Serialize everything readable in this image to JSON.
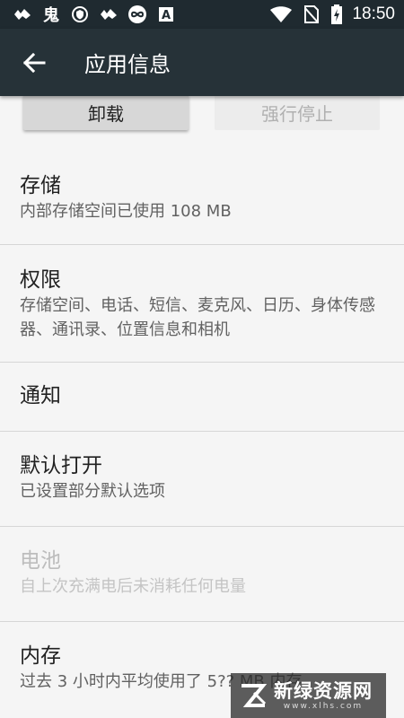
{
  "status_bar": {
    "time": "18:50",
    "left_icons": [
      "notification-app-icon",
      "ghost-app-icon",
      "shield-app-icon",
      "notification-app-icon",
      "infinity-app-icon",
      "font-app-icon"
    ],
    "right_icons": [
      "wifi-icon",
      "no-sim-icon",
      "battery-charging-icon"
    ]
  },
  "app_bar": {
    "title": "应用信息",
    "back_icon": "arrow-back-icon"
  },
  "buttons": {
    "uninstall": "卸载",
    "force_stop": "强行停止"
  },
  "items": [
    {
      "title": "存储",
      "subtitle": "内部存储空间已使用 108 MB",
      "enabled": true
    },
    {
      "title": "权限",
      "subtitle": "存储空间、电话、短信、麦克风、日历、身体传感器、通讯录、位置信息和相机",
      "enabled": true
    },
    {
      "title": "通知",
      "subtitle": "",
      "enabled": true
    },
    {
      "title": "默认打开",
      "subtitle": "已设置部分默认选项",
      "enabled": true
    },
    {
      "title": "电池",
      "subtitle": "自上次充满电后未消耗任何电量",
      "enabled": false
    },
    {
      "title": "内存",
      "subtitle": "过去 3 小时内平均使用了 5?? MB 内存",
      "enabled": true
    }
  ],
  "watermark": {
    "text": "新绿资源网",
    "url": "www.xlhs.com"
  },
  "colors": {
    "status_bar": "#1f2a30",
    "app_bar": "#263238",
    "background": "#f5f5f5"
  }
}
